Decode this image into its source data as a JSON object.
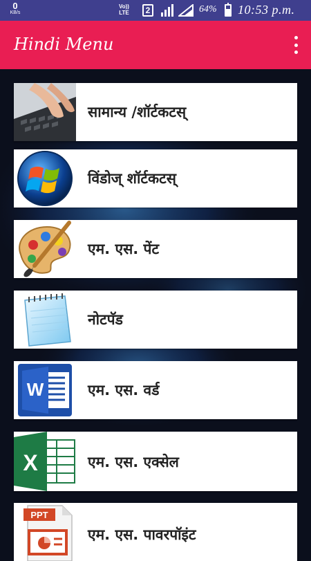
{
  "status_bar": {
    "kb_value": "0",
    "kb_unit": "KB/s",
    "volte_line1": "Vo))",
    "volte_line2": "LTE",
    "sim_slot": "2",
    "battery_percent": "64%",
    "battery_level": 0.64,
    "time": "10:53 p.m."
  },
  "app_bar": {
    "title": "Hindi Menu",
    "overflow_icon": "more-vert-icon"
  },
  "colors": {
    "status_bar": "#3f3f8e",
    "app_bar": "#e91e53",
    "background": "#0b0f1c",
    "card": "#ffffff"
  },
  "menu_items": [
    {
      "label": "सामान्य /शॉर्टकटस्",
      "icon": "keyboard-photo-icon"
    },
    {
      "label": "विंडोज् शॉर्टकटस्",
      "icon": "windows-logo-icon"
    },
    {
      "label": "एम. एस. पेंट",
      "icon": "paint-palette-icon"
    },
    {
      "label": "नोटपॅड",
      "icon": "notepad-icon"
    },
    {
      "label": "एम. एस. वर्ड",
      "icon": "ms-word-icon"
    },
    {
      "label": "एम. एस. एक्सेल",
      "icon": "ms-excel-icon"
    },
    {
      "label": "एम. एस. पावरपॉइंट",
      "icon": "ms-powerpoint-icon",
      "icon_text": "PPT"
    }
  ]
}
